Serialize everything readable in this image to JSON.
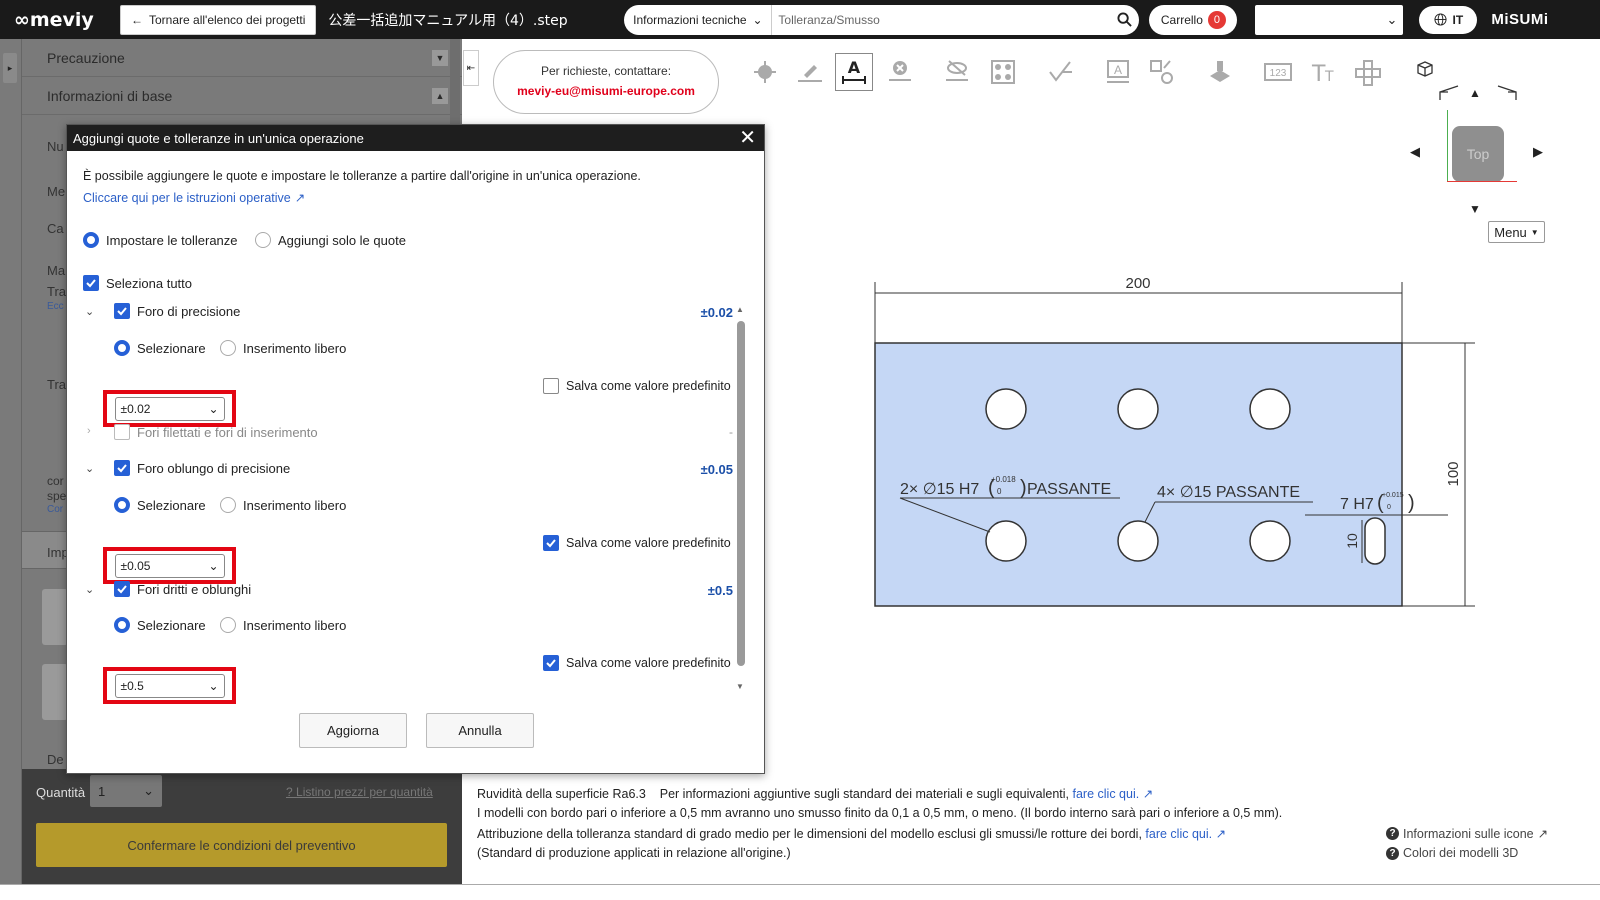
{
  "topbar": {
    "logo": "meviy",
    "back_label": "Tornare all'elenco dei progetti",
    "file_title": "公差一括追加マニュアル用（4）.step",
    "info_select": "Informazioni tecniche",
    "info_input_placeholder": "Tolleranza/Smusso",
    "cart_label": "Carrello",
    "cart_count": "0",
    "lang_label": "IT",
    "brand": "MiSUMi"
  },
  "left_panel": {
    "items": [
      {
        "label": "Precauzione"
      },
      {
        "label": "Informazioni di base"
      }
    ],
    "side_texts": [
      "Nu",
      "Me",
      "Ca",
      "Ma",
      "Tra",
      "Ecc",
      "Tra",
      "cor",
      "spe",
      "Cor",
      "Imp",
      "De"
    ]
  },
  "bottom_left": {
    "qty_label": "Quantità",
    "qty_value": "1",
    "price_link": "Listino prezzi per quantità",
    "confirm_label": "Confermare le condizioni del preventivo"
  },
  "contact": {
    "line1": "Per richieste, contattare:",
    "email": "meviy-eu@misumi-europe.com"
  },
  "viewer": {
    "cube_label": "Top",
    "menu_label": "Menu",
    "drawing": {
      "width_dim": "200",
      "height_dim": "100",
      "note1_prefix": "2× ∅15 H7",
      "note1_tol_upper": "+0.018",
      "note1_tol_lower": "0",
      "note1_suffix": "PASSANTE",
      "note2": "4× ∅15 PASSANTE",
      "note3_prefix": "7 H7",
      "note3_tol_upper": "+0.015",
      "note3_tol_lower": "0",
      "slot_dim": "10"
    }
  },
  "info_lines": {
    "line1_a": "Ruvidità della superficie Ra6.3",
    "line1_b": "Per informazioni aggiuntive sugli standard dei materiali e sugli equivalenti,",
    "line1_link": "fare clic qui.",
    "line2": "I modelli con bordo pari o inferiore a 0,5 mm avranno uno smusso finito da 0,1 a 0,5 mm, o meno. (Il bordo interno sarà pari o inferiore a 0,5 mm).",
    "line3": "Attribuzione della tolleranza standard di grado medio per le dimensioni del modello esclusi gli smussi/le rotture dei bordi,",
    "line3_link": "fare clic qui.",
    "line4": "(Standard di produzione applicati in relazione all'origine.)"
  },
  "help": {
    "icons_info": "Informazioni sulle icone",
    "colors_3d": "Colori dei modelli 3D"
  },
  "modal": {
    "title": "Aggiungi quote e tolleranze in un'unica operazione",
    "description": "È possibile aggiungere le quote e impostare le tolleranze a partire dall'origine in un'unica operazione.",
    "instructions_link": "Cliccare qui per le istruzioni operative",
    "mode_set_tolerances": "Impostare le tolleranze",
    "mode_add_only": "Aggiungi solo le quote",
    "select_all": "Seleziona tutto",
    "groups": [
      {
        "label": "Foro di precisione",
        "value": "±0.02",
        "select_label": "Selezionare",
        "free_label": "Inserimento libero",
        "dropdown": "±0.02",
        "save_default": "Salva come valore predefinito",
        "save_checked": false
      },
      {
        "label": "Fori filettati e fori di inserimento",
        "value": "-"
      },
      {
        "label": "Foro oblungo di precisione",
        "value": "±0.05",
        "select_label": "Selezionare",
        "free_label": "Inserimento libero",
        "dropdown": "±0.05",
        "save_default": "Salva come valore predefinito",
        "save_checked": true
      },
      {
        "label": "Fori dritti e oblunghi",
        "value": "±0.5",
        "select_label": "Selezionare",
        "free_label": "Inserimento libero",
        "dropdown": "±0.5",
        "save_default": "Salva come valore predefinito",
        "save_checked": true
      }
    ],
    "update_label": "Aggiorna",
    "cancel_label": "Annulla"
  },
  "colors": {
    "accent_blue": "#2660d6",
    "highlight_red": "#e30613",
    "part_fill": "#c5d7f5",
    "confirm_gold": "#b59a2b"
  }
}
